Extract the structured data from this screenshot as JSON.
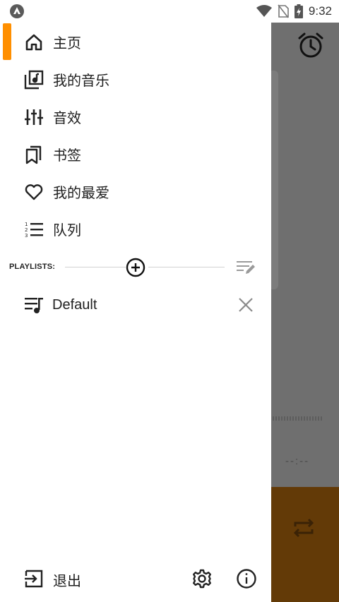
{
  "status_bar": {
    "time": "9:32",
    "left_icon": "app-notification-icon",
    "icons": [
      "wifi-icon",
      "no-sim-icon",
      "battery-charging-icon"
    ]
  },
  "drawer": {
    "nav_items": [
      {
        "label": "主页",
        "icon": "home-icon",
        "active": true
      },
      {
        "label": "我的音乐",
        "icon": "music-library-icon"
      },
      {
        "label": "音效",
        "icon": "equalizer-icon"
      },
      {
        "label": "书签",
        "icon": "bookmarks-icon"
      },
      {
        "label": "我的最爱",
        "icon": "heart-icon"
      },
      {
        "label": "队列",
        "icon": "queue-list-icon"
      }
    ],
    "playlists": {
      "header": "PLAYLISTS:",
      "items": [
        {
          "label": "Default",
          "icon": "playlist-icon"
        }
      ]
    },
    "footer": {
      "exit_label": "退出"
    }
  },
  "colors": {
    "accent": "#ff8f00",
    "scrim": "#6f6f6f",
    "player_bar": "#633a07"
  },
  "background_app": {
    "time_display": "--:--"
  }
}
